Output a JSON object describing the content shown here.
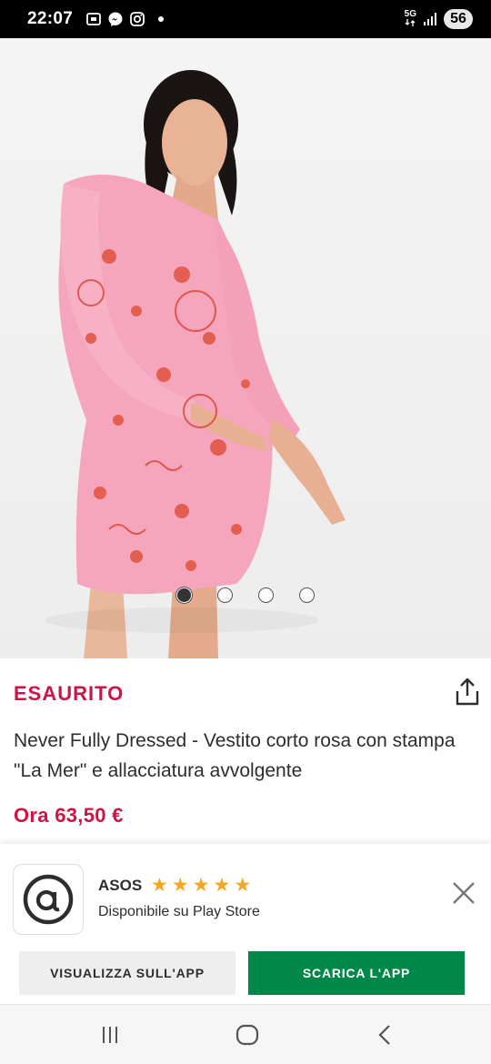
{
  "status_bar": {
    "time": "22:07",
    "left_icons": [
      "screenshot-icon",
      "messenger-icon",
      "instagram-icon",
      "notification-dot"
    ],
    "network_label": "5G",
    "signal_icon": "signal-icon",
    "battery": "56"
  },
  "product": {
    "image_alt_icon": "product-photo",
    "carousel": {
      "count": 4,
      "active_index": 0
    },
    "status": "ESAURITO",
    "title": "Never Fully Dressed - Vestito corto rosa con stampa \"La Mer\" e allacciatura avvolgente",
    "price": "Ora 63,50 €",
    "share_icon": "share-icon"
  },
  "app_banner": {
    "app_icon": "asos-a-icon",
    "name": "ASOS",
    "rating": 5,
    "rating_max": 5,
    "availability": "Disponibile su Play Store",
    "close_icon": "close-icon",
    "view_label": "VISUALIZZA SULL'APP",
    "download_label": "SCARICA L'APP",
    "colors": {
      "accent_green": "#018849",
      "sale_red": "#d01345",
      "star": "#f5a623"
    }
  },
  "nav_bar": {
    "recents_icon": "recents-icon",
    "home_icon": "home-icon",
    "back_icon": "back-icon"
  }
}
